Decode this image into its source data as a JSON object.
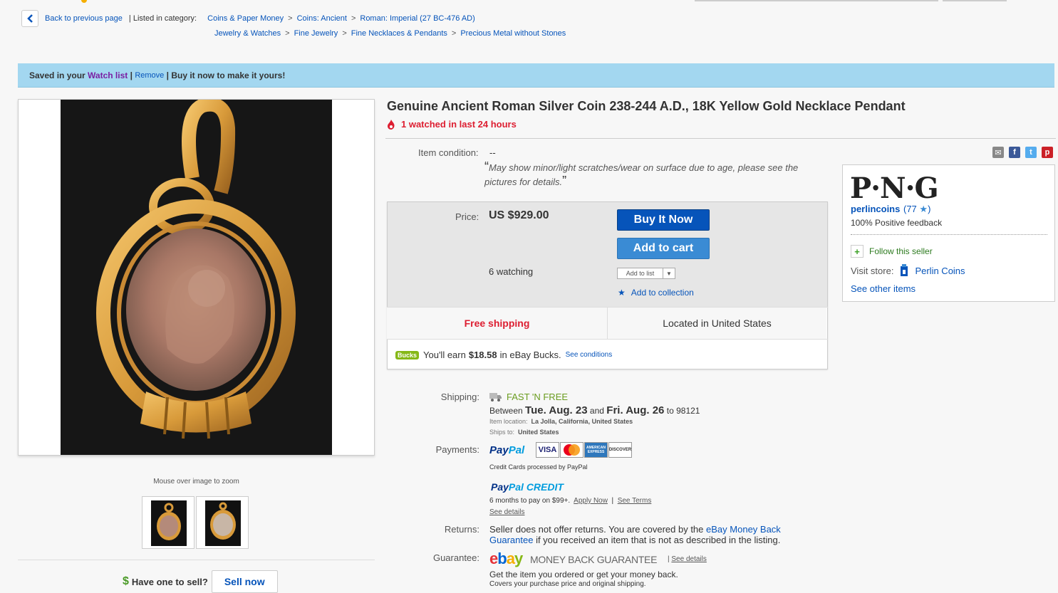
{
  "nav": {
    "back": "Back to previous page",
    "listed_in": "| Listed in category:",
    "crumbs_1": [
      "Coins & Paper Money",
      "Coins: Ancient",
      "Roman: Imperial (27 BC-476 AD)"
    ],
    "crumbs_2": [
      "Jewelry & Watches",
      "Fine Jewelry",
      "Fine Necklaces & Pendants",
      "Precious Metal without Stones"
    ],
    "sep": ">"
  },
  "banner": {
    "saved": "Saved in your",
    "watch_list": "Watch list",
    "bar1": "|",
    "remove": "Remove",
    "rest": "| Buy it now to make it yours!"
  },
  "gallery": {
    "zoom_hint": "Mouse over image to zoom"
  },
  "sell": {
    "dollar": "$",
    "prompt": "Have one to sell?",
    "button": "Sell now"
  },
  "item": {
    "title": "Genuine Ancient Roman Silver Coin 238-244 A.D., 18K Yellow Gold Necklace Pendant",
    "watched": "1 watched in last 24 hours",
    "condition_label": "Item condition:",
    "condition_value": "--",
    "condition_note": "May show minor/light scratches/wear on surface due to age, please see the pictures for details."
  },
  "buy": {
    "price_label": "Price:",
    "price": "US $929.00",
    "watching": "6 watching",
    "buy_now": "Buy It Now",
    "add_cart": "Add to cart",
    "add_list": "Add to list",
    "add_collection": "Add to collection",
    "free_shipping": "Free shipping",
    "located": "Located in United States",
    "bucks_badge": "Bucks",
    "bucks_pre": "You'll earn",
    "bucks_amount": "$18.58",
    "bucks_post": "in eBay Bucks.",
    "bucks_conditions": "See conditions"
  },
  "seller": {
    "logo": "P·N·G",
    "name": "perlincoins",
    "score_open": "(77",
    "score_star": "★",
    "score_close": ")",
    "feedback": "100% Positive feedback",
    "follow": "Follow this seller",
    "visit": "Visit store:",
    "store_name": "Perlin Coins",
    "other_items": "See other items"
  },
  "details": {
    "shipping_label": "Shipping:",
    "fast": "FAST 'N FREE",
    "between": "Between",
    "date1": "Tue. Aug. 23",
    "and": "and",
    "date2": "Fri. Aug. 26",
    "to": "to 98121",
    "item_loc_label": "Item location:",
    "item_loc": "La Jolla, California, United States",
    "ships_to_label": "Ships to:",
    "ships_to": "United States",
    "payments_label": "Payments:",
    "paypal_a": "Pay",
    "paypal_b": "Pal",
    "cards": [
      "VISA",
      "MasterCard",
      "AMERICAN EXPRESS",
      "DISCOVER"
    ],
    "cc_note": "Credit Cards processed by PayPal",
    "ppc_a": "Pay",
    "ppc_b": "Pal CREDIT",
    "ppc_months": "6 months to pay on $99+.",
    "ppc_apply": "Apply Now",
    "ppc_bar": "|",
    "ppc_terms": "See Terms",
    "ppc_details": "See details",
    "returns_label": "Returns:",
    "returns_pre": "Seller does not offer returns. You are covered by the",
    "returns_link": "eBay Money Back Guarantee",
    "returns_post": "if you received an item that is not as described in the listing.",
    "guarantee_label": "Guarantee:",
    "mbg": "MONEY BACK GUARANTEE",
    "mbg_bar": "|",
    "mbg_details": "See details",
    "guar_1": "Get the item you ordered or get your money back.",
    "guar_2": "Covers your purchase price and original shipping."
  },
  "colors": {
    "link": "#0654ba",
    "banner": "#a3d7f0",
    "buy_button": "#0654ba",
    "cart_button": "#3a8bd4",
    "alert_red": "#dd1e31",
    "fast_green": "#6a9c1f"
  }
}
